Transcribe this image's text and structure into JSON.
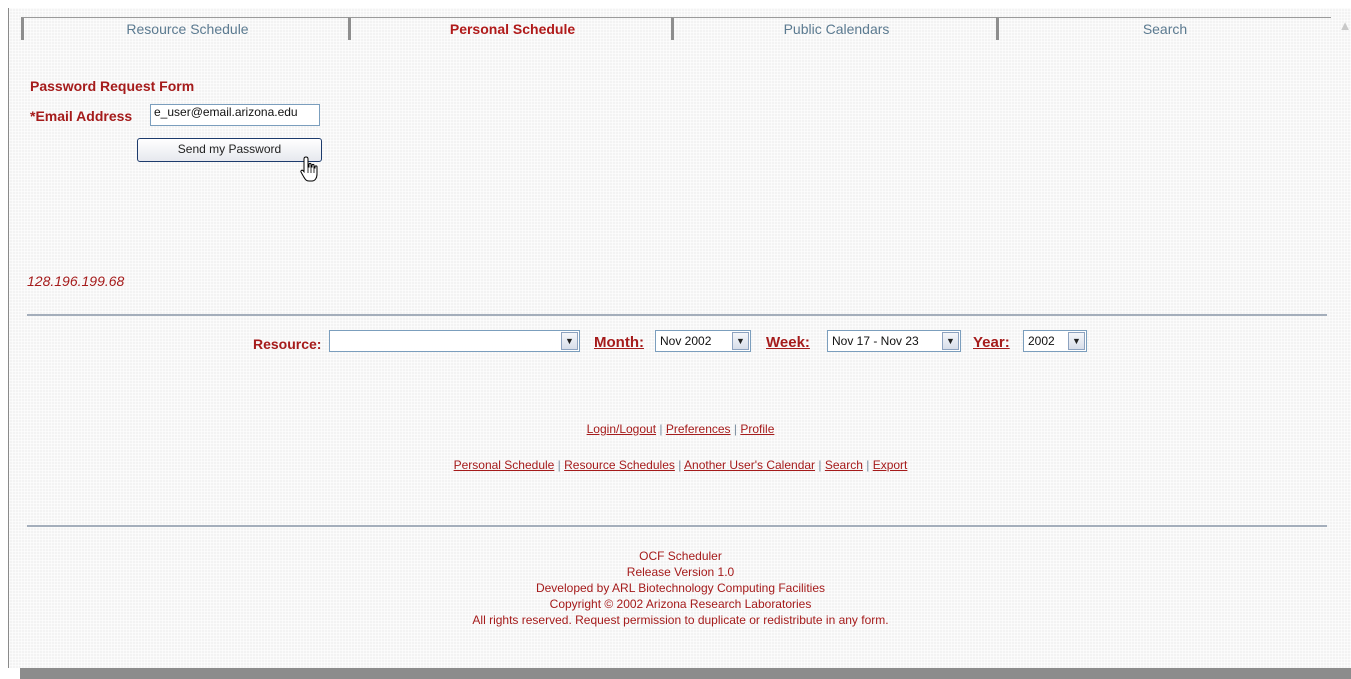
{
  "tabs": [
    {
      "label": "Resource Schedule",
      "active": false
    },
    {
      "label": "Personal Schedule",
      "active": true
    },
    {
      "label": "Public Calendars",
      "active": false
    },
    {
      "label": "Search",
      "active": false
    }
  ],
  "form": {
    "title": "Password Request Form",
    "email_label": "*Email Address",
    "email_value": "e_user@email.arizona.edu",
    "send_button": "Send my Password"
  },
  "ip_address": "128.196.199.68",
  "filters": {
    "resource_label": "Resource:",
    "resource_value": "",
    "month_label": "Month:",
    "month_value": "Nov 2002",
    "week_label": "Week:",
    "week_value": "Nov 17 - Nov 23",
    "year_label": "Year:",
    "year_value": "2002"
  },
  "links_row1": [
    "Login/Logout",
    "Preferences",
    "Profile"
  ],
  "links_row2": [
    "Personal Schedule",
    "Resource Schedules",
    "Another User's Calendar",
    "Search",
    "Export"
  ],
  "separator": "|",
  "footer": {
    "app_name": "OCF Scheduler",
    "version": "Release Version 1.0",
    "developer": "Developed by ARL Biotechnology Computing Facilities",
    "copyright": "Copyright © 2002 Arizona Research Laboratories",
    "rights": "All rights reserved. Request permission to duplicate or redistribute in any form."
  },
  "colors": {
    "accent_red": "#a51b1b",
    "tab_text": "#5b7a90",
    "divider": "#a4aebb"
  },
  "icons": {
    "cursor": "hand-pointer-icon",
    "dropdown": "chevron-down-icon",
    "scroll": "scroll-up-arrow-icon"
  }
}
